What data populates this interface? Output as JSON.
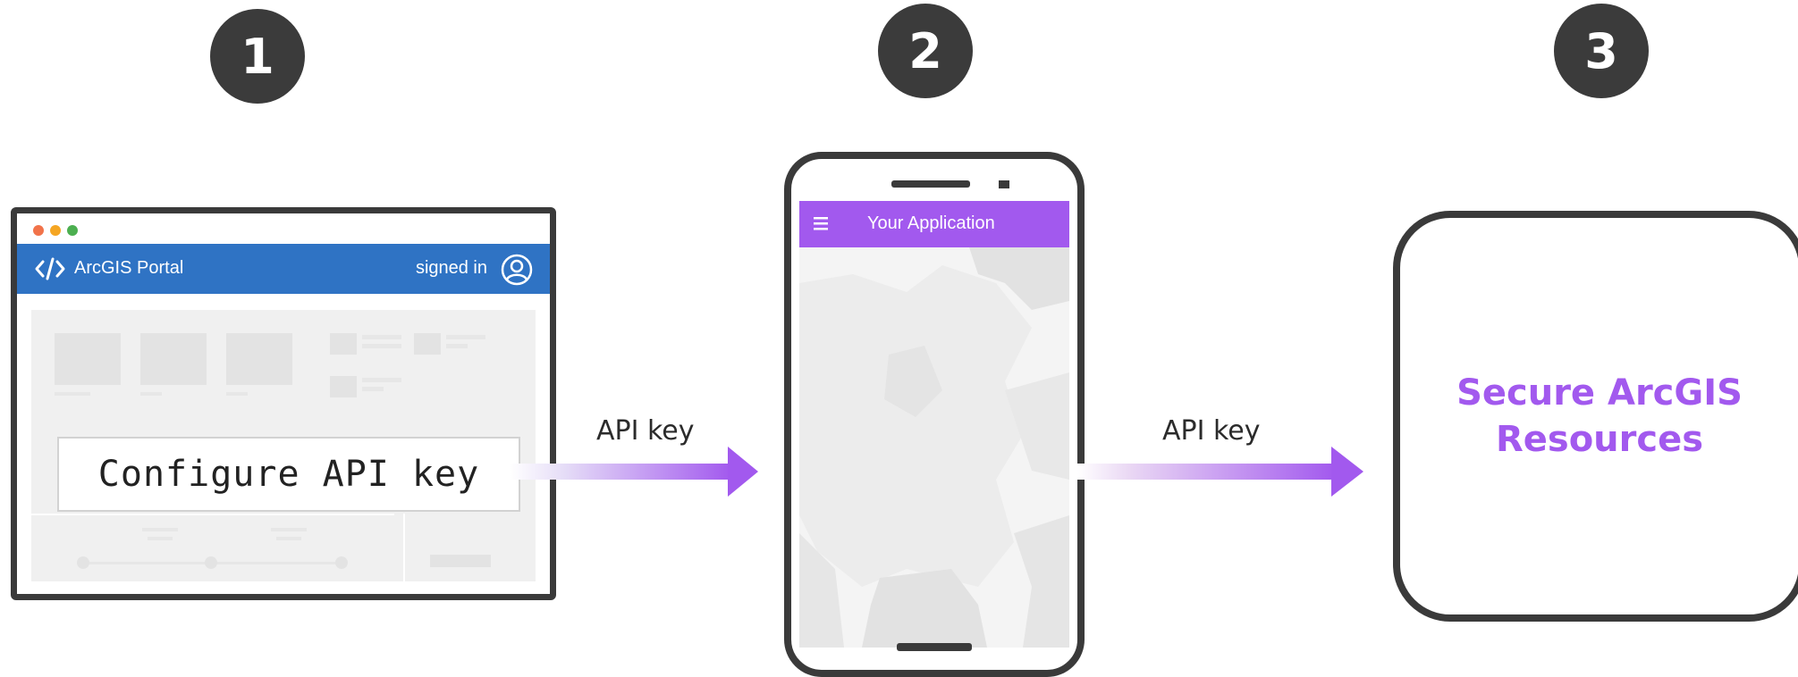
{
  "steps": [
    "1",
    "2",
    "3"
  ],
  "portal": {
    "title": "ArcGIS Portal",
    "signed_in": "signed in",
    "configure_label": "Configure API key",
    "icons": [
      "code-icon",
      "user-icon"
    ]
  },
  "arrows": {
    "label_1": "API key",
    "label_2": "API key"
  },
  "phone": {
    "app_title": "Your Application",
    "icons": [
      "hamburger-menu-icon"
    ]
  },
  "resources": {
    "line1": "Secure ArcGIS",
    "line2": "Resources"
  },
  "colors": {
    "accent_purple": "#a259ee",
    "portal_blue": "#2f73c4",
    "outline": "#3a3a3a",
    "step_circle": "#3b3b3b",
    "window_dot_1": "#f1734a",
    "window_dot_2": "#f5a623",
    "window_dot_3": "#4caf50"
  }
}
